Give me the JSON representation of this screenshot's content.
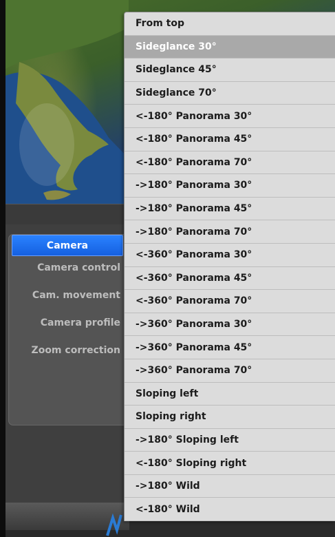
{
  "sidebar": {
    "active_tab": "Camera",
    "items": [
      "Camera control",
      "Cam. movement",
      "Camera profile",
      "Zoom correction"
    ]
  },
  "menu": {
    "highlighted_index": 1,
    "items": [
      "From top",
      "Sideglance 30°",
      "Sideglance 45°",
      "Sideglance 70°",
      "<-180° Panorama 30°",
      "<-180° Panorama 45°",
      "<-180° Panorama 70°",
      "->180° Panorama 30°",
      "->180° Panorama 45°",
      "->180° Panorama 70°",
      "<-360° Panorama 30°",
      "<-360° Panorama 45°",
      "<-360° Panorama 70°",
      "->360° Panorama 30°",
      "->360° Panorama 45°",
      "->360° Panorama 70°",
      "Sloping left",
      "Sloping right",
      "->180° Sloping left",
      "<-180° Sloping right",
      "->180° Wild",
      "<-180° Wild"
    ]
  },
  "colors": {
    "accent": "#1f6ff0",
    "menu_bg": "#dcdcdc",
    "menu_highlight": "#a9a9a9"
  }
}
